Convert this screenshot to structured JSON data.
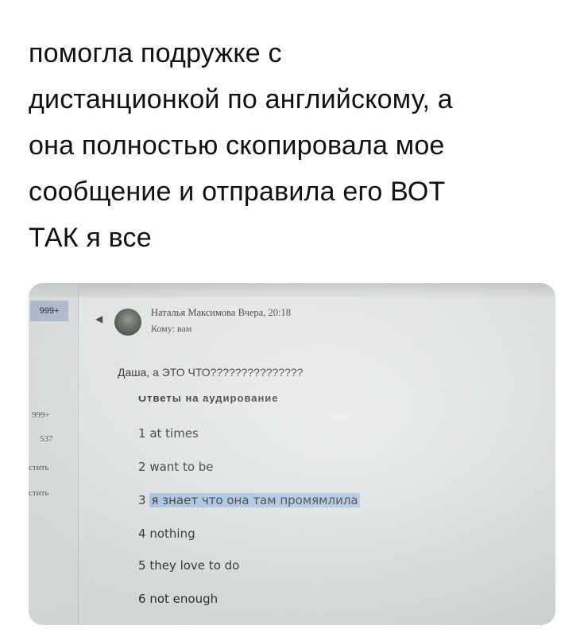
{
  "tweet": {
    "lines": [
      "помогла подружке с",
      "дистанционкой по английскому, а",
      "она полностью скопировала мое",
      "сообщение и отправила его ВОТ",
      "ТАК я все"
    ]
  },
  "email": {
    "sidebar": {
      "badge": "999+",
      "count_1": "999+",
      "count_2": "537",
      "label_1": "стить",
      "label_2": "стить"
    },
    "back_icon": "back-arrow-icon",
    "sender_line": "Наталья Максимова Вчера, 20:18",
    "recipient_line": "Кому: вам",
    "message_line": "Даша, а ЭТО ЧТО???????????????",
    "doc_heading": "Ответы на аудирование",
    "answers": [
      {
        "number": "1",
        "text": "at times"
      },
      {
        "number": "2",
        "text": "want to be"
      },
      {
        "number": "3",
        "text": "я знает что она там промямлила"
      },
      {
        "number": "4",
        "text": "nothing"
      },
      {
        "number": "5",
        "text": "they love to do"
      },
      {
        "number": "6",
        "text": "not enough"
      }
    ]
  }
}
